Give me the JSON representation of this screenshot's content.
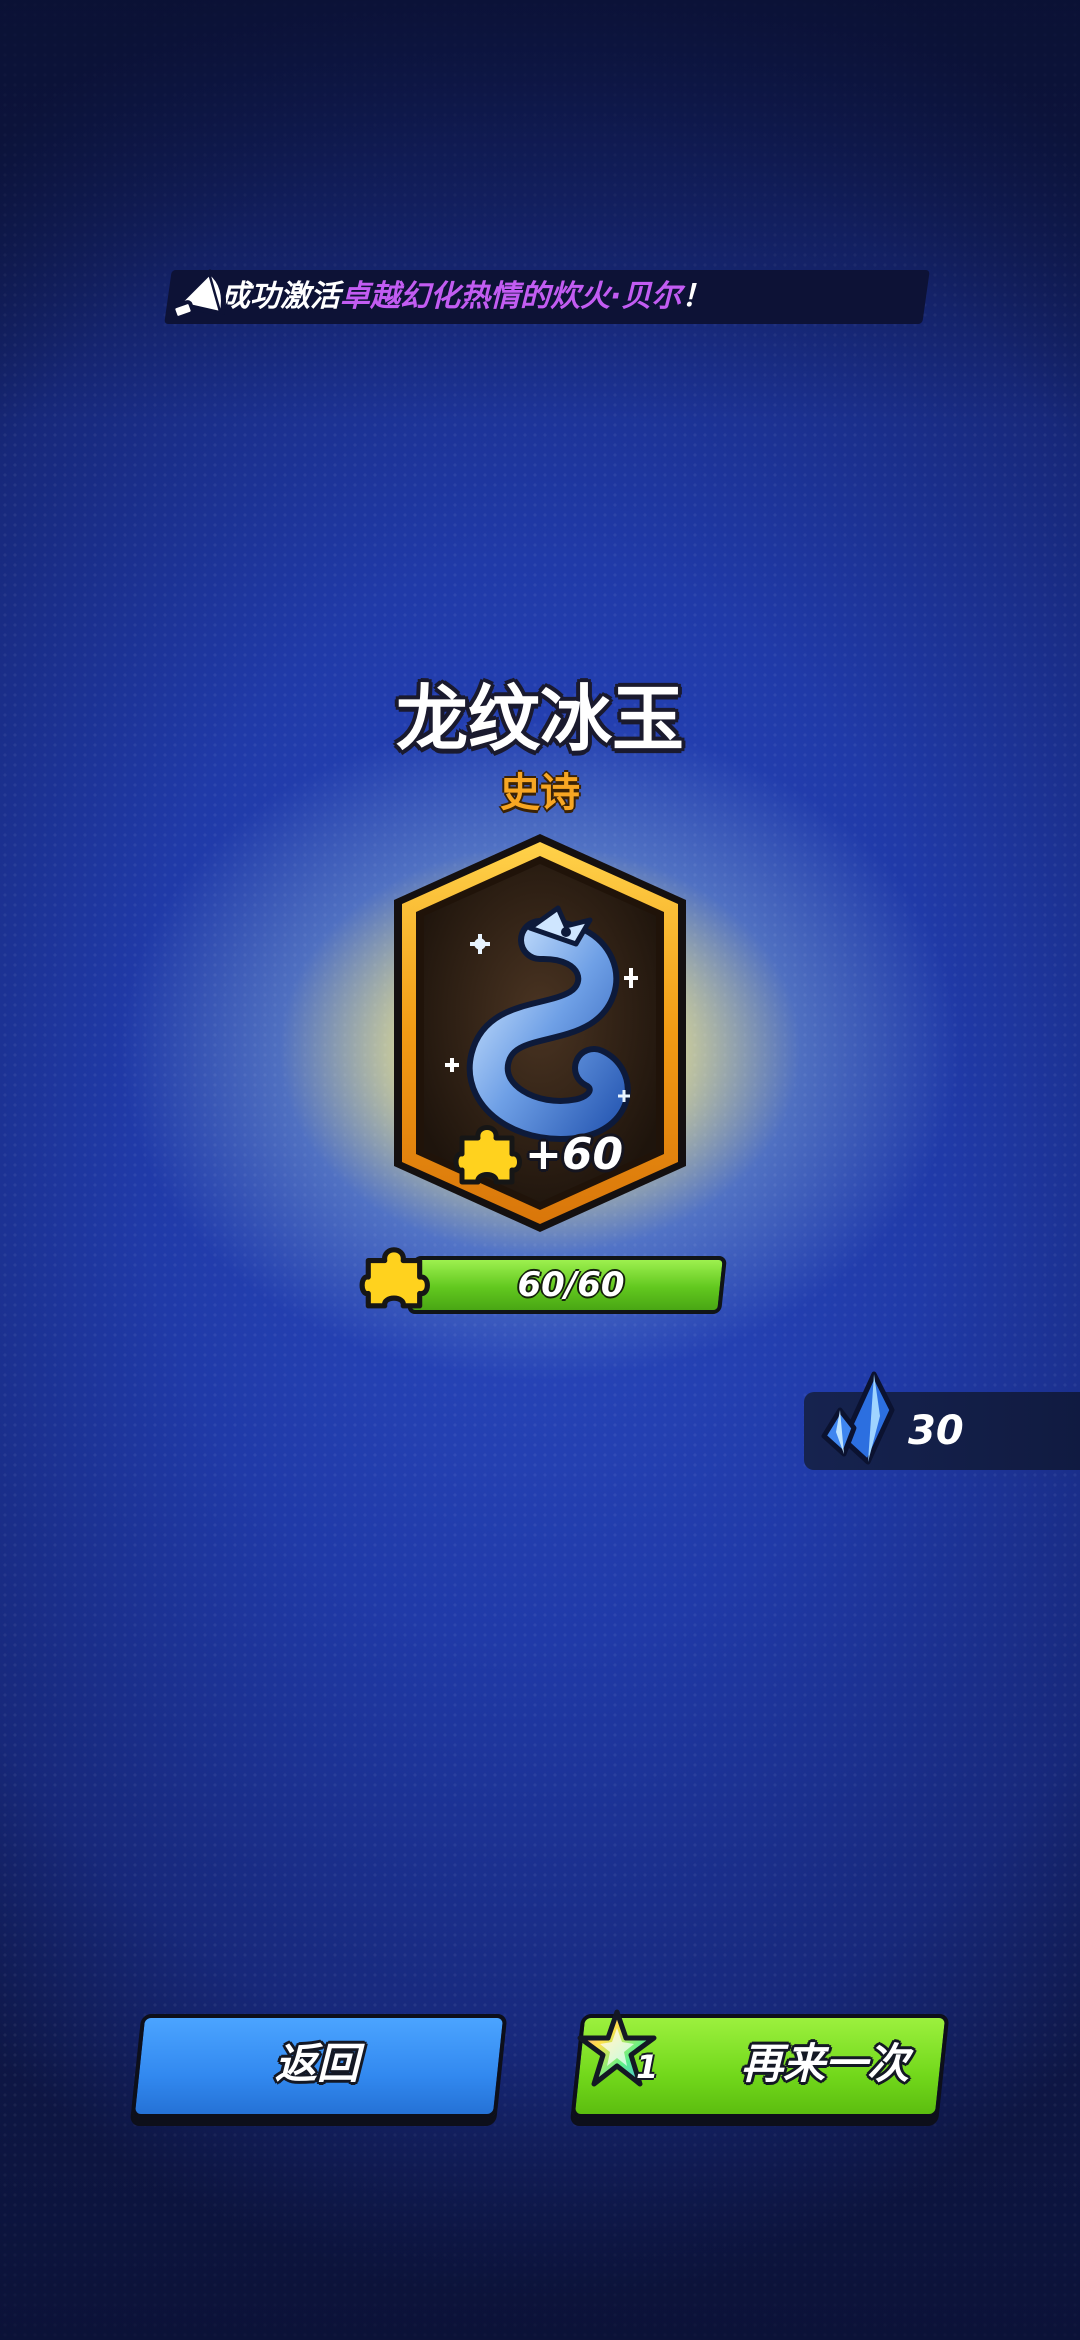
{
  "announcement": {
    "prefix": "成功激活",
    "highlight": "卓越幻化热情的炊火·贝尔",
    "suffix": "！",
    "icon": "megaphone-icon"
  },
  "reward": {
    "name": "龙纹冰玉",
    "rarity": "史诗",
    "amount": "+60",
    "icon": "ice-jade-dragon-icon",
    "fragment_icon": "puzzle-piece-icon"
  },
  "progress": {
    "text": "60/60",
    "fraction": 1.0
  },
  "currency": {
    "icon": "blue-crystal-icon",
    "value": "30"
  },
  "buttons": {
    "back_label": "返回",
    "again_label": "再来一次",
    "again_cost": "1",
    "again_cost_icon": "rainbow-star-icon"
  },
  "colors": {
    "rarity": "#f7a623",
    "highlight": "#c25cf2",
    "back_button": "#3289f0",
    "again_button": "#72d81b",
    "progress_fill": "#62c81f"
  }
}
